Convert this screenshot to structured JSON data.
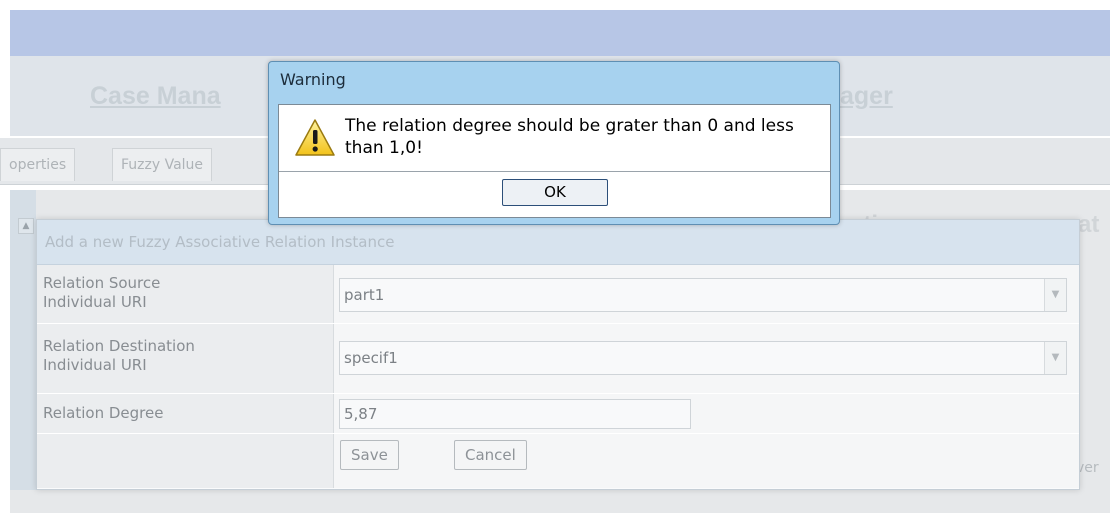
{
  "app": {
    "title_left": "Case Mana",
    "title_right": "ager"
  },
  "tabs": [
    {
      "label": "operties"
    },
    {
      "label": "Fuzzy Value"
    }
  ],
  "background": {
    "heading_fragment": "ati",
    "heading_fragment_end": "at",
    "side_text": "ver"
  },
  "form_dialog": {
    "title": "Add a new Fuzzy Associative Relation Instance",
    "fields": [
      {
        "label_line1": "Relation Source",
        "label_line2": "Individual URI",
        "value": "part1"
      },
      {
        "label_line1": "Relation Destination",
        "label_line2": "Individual URI",
        "value": "specif1"
      },
      {
        "label_line1": "Relation Degree",
        "value": "5,87"
      }
    ],
    "save_label": "Save",
    "cancel_label": "Cancel"
  },
  "warning_dialog": {
    "title": "Warning",
    "message": "The relation degree should be grater than 0 and less than 1,0!",
    "ok_label": "OK",
    "icon": "warning-icon"
  },
  "colors": {
    "topbar": "#b7c6e6",
    "dialog_frame": "#a7d2ef",
    "warning_yellow": "#f7d21e"
  }
}
